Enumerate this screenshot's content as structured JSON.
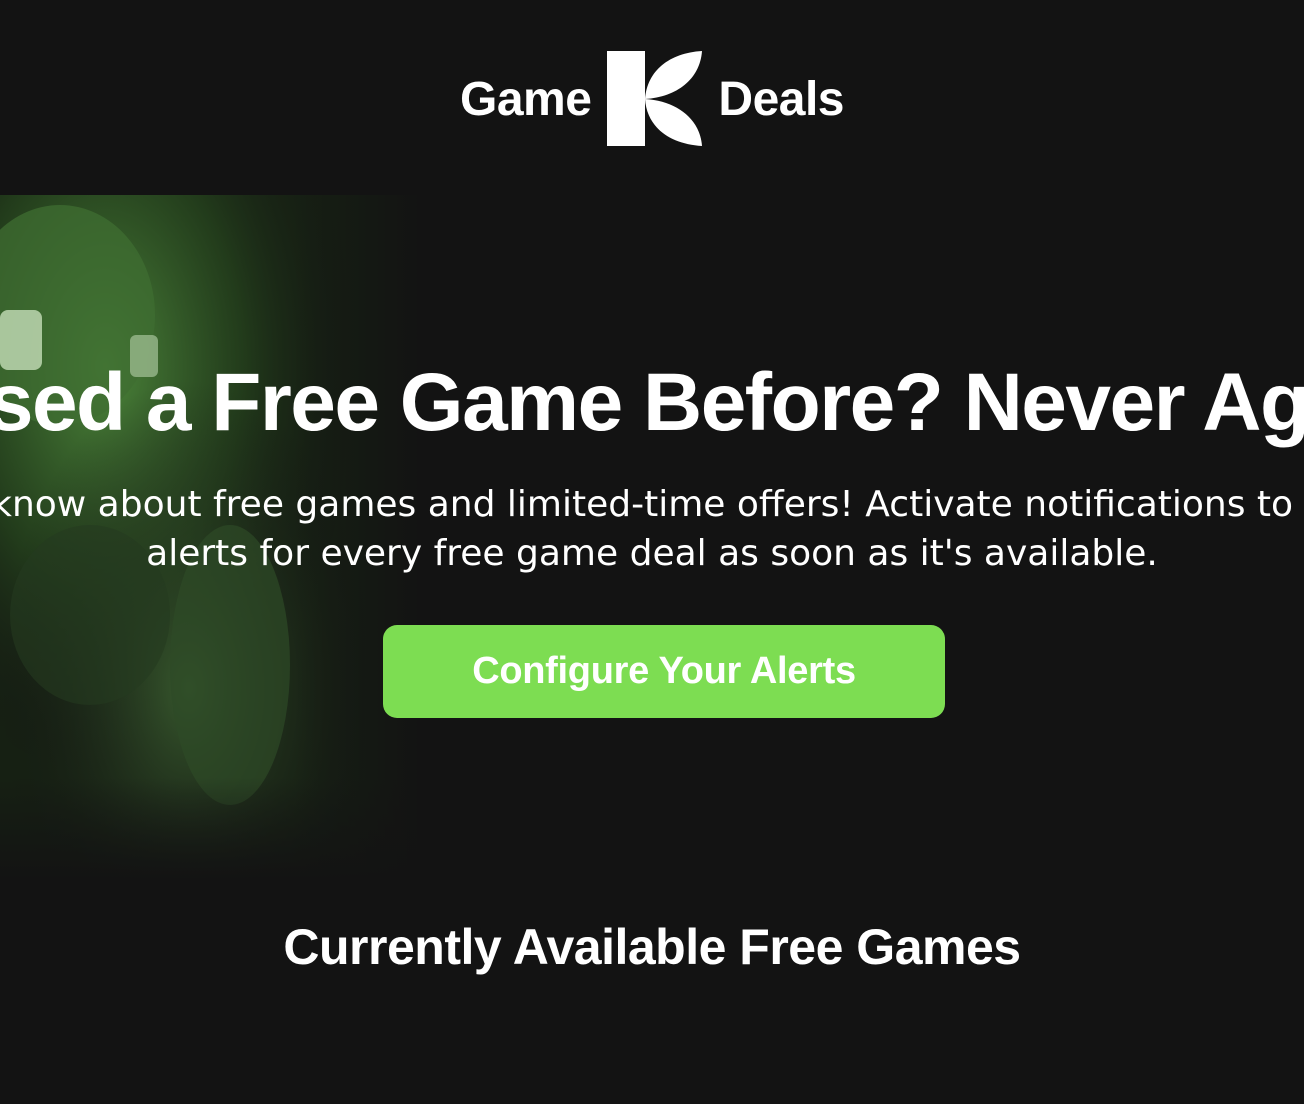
{
  "header": {
    "brand_left": "Game",
    "brand_right": "Deals",
    "logo_icon": "k-logo-icon"
  },
  "hero": {
    "title": "Missed a Free Game Before? Never Again!",
    "subtitle_line1": "Get to know about free games and limited-time offers! Activate notifications to receive",
    "subtitle_line2": "alerts for every free game deal as soon as it's available.",
    "cta_label": "Configure Your Alerts",
    "background_image": "green-tinted-gamer-image"
  },
  "section": {
    "title": "Currently Available Free Games"
  },
  "colors": {
    "background": "#131313",
    "accent": "#7ddd52",
    "text": "#ffffff"
  }
}
